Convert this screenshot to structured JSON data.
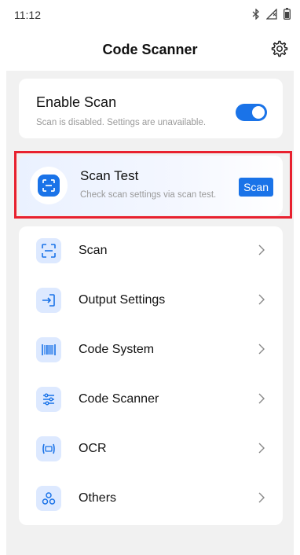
{
  "status_bar": {
    "time": "11:12",
    "icons": [
      "bluetooth-icon",
      "signal-icon",
      "battery-icon"
    ]
  },
  "app_bar": {
    "title": "Code Scanner",
    "settings_icon": "gear-icon"
  },
  "enable_scan": {
    "title": "Enable Scan",
    "subtitle": "Scan is disabled. Settings are unavailable.",
    "toggle_on": true
  },
  "scan_test": {
    "title": "Scan Test",
    "subtitle": "Check scan settings via scan test.",
    "button_label": "Scan",
    "highlighted": true
  },
  "menu": {
    "items": [
      {
        "label": "Scan",
        "icon": "scan-frame-icon"
      },
      {
        "label": "Output Settings",
        "icon": "output-arrow-icon"
      },
      {
        "label": "Code System",
        "icon": "barcode-icon"
      },
      {
        "label": "Code Scanner",
        "icon": "sliders-icon"
      },
      {
        "label": "OCR",
        "icon": "ocr-icon"
      },
      {
        "label": "Others",
        "icon": "others-icon"
      }
    ]
  },
  "colors": {
    "accent": "#1a73e8",
    "highlight": "#e8212f",
    "icon_bg": "#dde9ff",
    "background": "#f1f1f1"
  }
}
